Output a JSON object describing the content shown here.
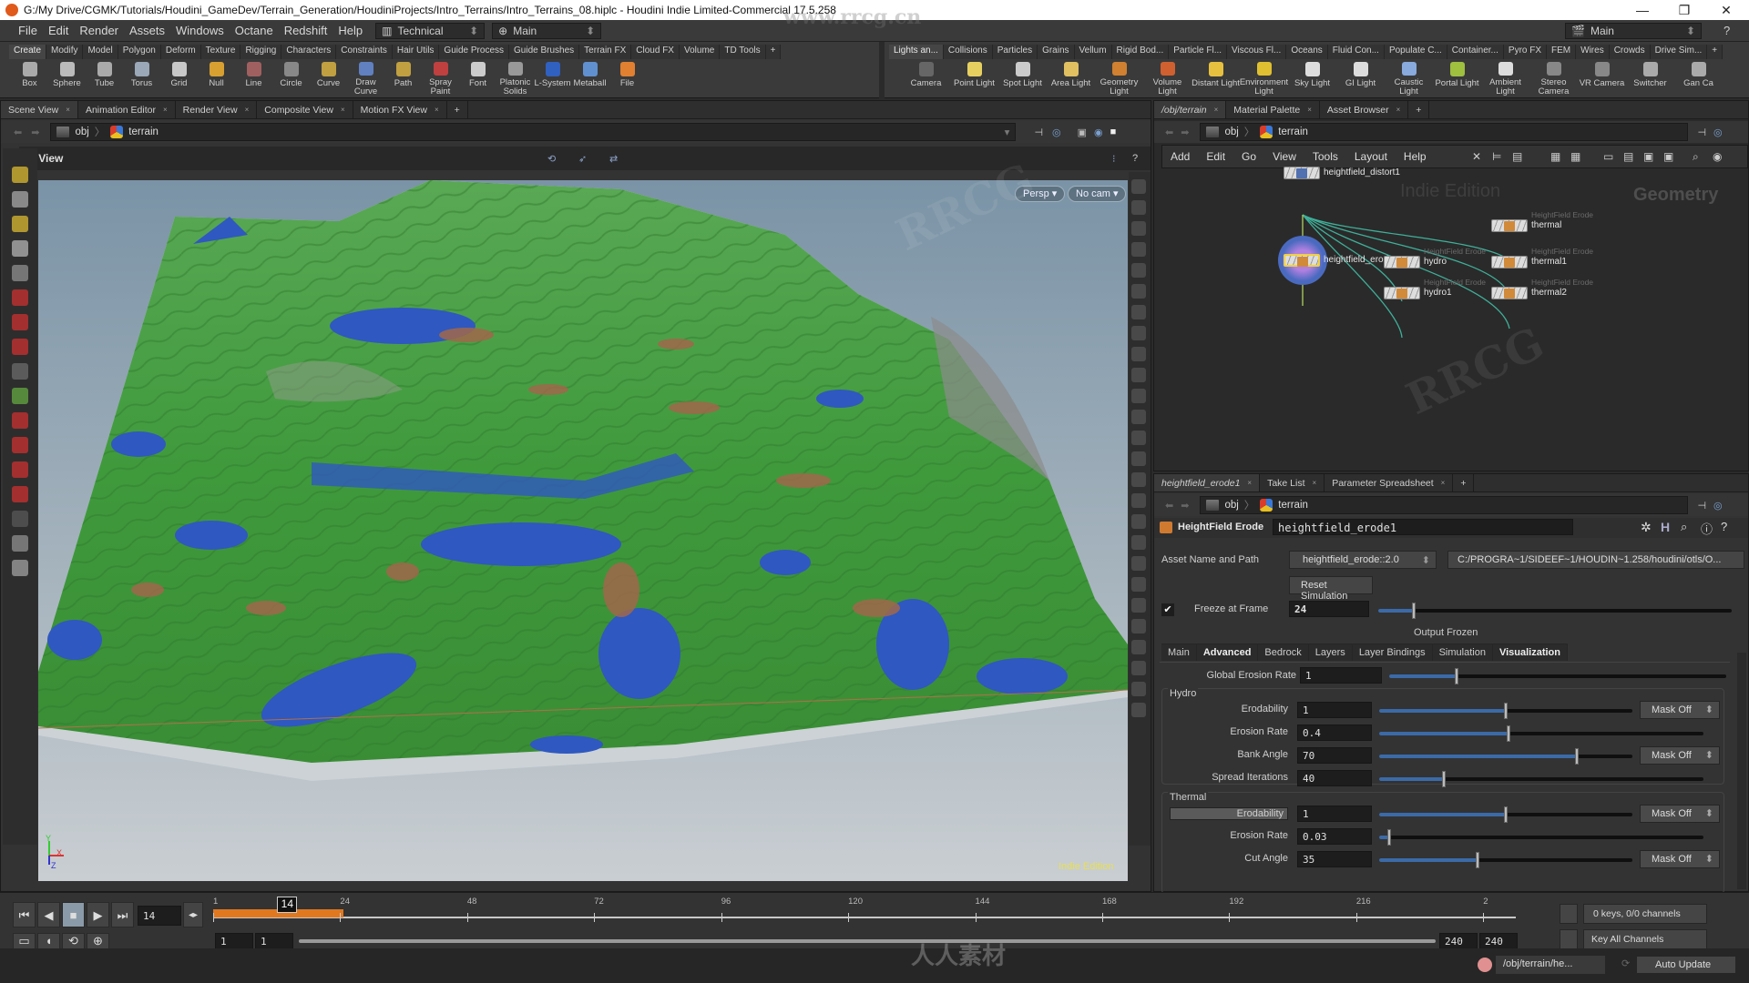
{
  "window": {
    "title": "G:/My Drive/CGMK/Tutorials/Houdini_GameDev/Terrain_Generation/HoudiniProjects/Intro_Terrains/Intro_Terrains_08.hiplc - Houdini Indie Limited-Commercial 17.5.258",
    "minimize": "—",
    "maximize": "❐",
    "close": "✕"
  },
  "menu": {
    "items": [
      "File",
      "Edit",
      "Render",
      "Assets",
      "Windows",
      "Octane",
      "Redshift",
      "Help"
    ],
    "desktop": "Technical",
    "context": "Main",
    "right_context": "Main"
  },
  "shelf_left": {
    "tabs": [
      "Create",
      "Modify",
      "Model",
      "Polygon",
      "Deform",
      "Texture",
      "Rigging",
      "Characters",
      "Constraints",
      "Hair Utils",
      "Guide Process",
      "Guide Brushes",
      "Terrain FX",
      "Cloud FX",
      "Volume",
      "TD Tools",
      "+"
    ],
    "tools": [
      {
        "label": "Box",
        "color": "#aaaaaa"
      },
      {
        "label": "Sphere",
        "color": "#bbbbbb"
      },
      {
        "label": "Tube",
        "color": "#aaaaaa"
      },
      {
        "label": "Torus",
        "color": "#9aa8b8"
      },
      {
        "label": "Grid",
        "color": "#c8c8c8"
      },
      {
        "label": "Null",
        "color": "#d8a030"
      },
      {
        "label": "Line",
        "color": "#a06060"
      },
      {
        "label": "Circle",
        "color": "#888888"
      },
      {
        "label": "Curve",
        "color": "#c0a040"
      },
      {
        "label": "Draw Curve",
        "color": "#6080c0"
      },
      {
        "label": "Path",
        "color": "#c0a040"
      },
      {
        "label": "Spray Paint",
        "color": "#c04040"
      },
      {
        "label": "Font",
        "color": "#cccccc"
      },
      {
        "label": "Platonic Solids",
        "color": "#999999"
      },
      {
        "label": "L-System",
        "color": "#3060c0"
      },
      {
        "label": "Metaball",
        "color": "#6090d0"
      },
      {
        "label": "File",
        "color": "#e08030"
      }
    ]
  },
  "shelf_right": {
    "tabs": [
      "Lights an...",
      "Collisions",
      "Particles",
      "Grains",
      "Vellum",
      "Rigid Bod...",
      "Particle Fl...",
      "Viscous Fl...",
      "Oceans",
      "Fluid Con...",
      "Populate C...",
      "Container...",
      "Pyro FX",
      "FEM",
      "Wires",
      "Crowds",
      "Drive Sim...",
      "+"
    ],
    "tools": [
      {
        "label": "Camera",
        "color": "#666666"
      },
      {
        "label": "Point Light",
        "color": "#e8d060"
      },
      {
        "label": "Spot Light",
        "color": "#cccccc"
      },
      {
        "label": "Area Light",
        "color": "#e0c060"
      },
      {
        "label": "Geometry Light",
        "color": "#d08030"
      },
      {
        "label": "Volume Light",
        "color": "#d06030"
      },
      {
        "label": "Distant Light",
        "color": "#e8c040"
      },
      {
        "label": "Environment Light",
        "color": "#e0c030"
      },
      {
        "label": "Sky Light",
        "color": "#dddddd"
      },
      {
        "label": "GI Light",
        "color": "#dddddd"
      },
      {
        "label": "Caustic Light",
        "color": "#88aadd"
      },
      {
        "label": "Portal Light",
        "color": "#a0c040"
      },
      {
        "label": "Ambient Light",
        "color": "#dddddd"
      },
      {
        "label": "Stereo Camera",
        "color": "#888888"
      },
      {
        "label": "VR Camera",
        "color": "#888888"
      },
      {
        "label": "Switcher",
        "color": "#aaaaaa"
      },
      {
        "label": "Gan Ca",
        "color": "#aaaaaa"
      }
    ]
  },
  "scene_panel": {
    "tabs": [
      "Scene View",
      "Animation Editor",
      "Render View",
      "Composite View",
      "Motion FX View",
      "+"
    ],
    "path": [
      "obj",
      "terrain"
    ],
    "view_label": "View",
    "persp_button": "Persp ▾",
    "cam_button": "No cam ▾",
    "indie_label": "Indie Edition",
    "axis": {
      "x": "X",
      "y": "Y",
      "z": "Z"
    }
  },
  "network_panel": {
    "tabs": [
      "/obj/terrain",
      "Material Palette",
      "Asset Browser",
      "+"
    ],
    "path": [
      "obj",
      "terrain"
    ],
    "menu": [
      "Add",
      "Edit",
      "Go",
      "View",
      "Tools",
      "Layout",
      "Help"
    ],
    "watermark_indie": "Indie Edition",
    "context_label": "Geometry",
    "nodes": [
      {
        "name": "heightfield_distort1",
        "type": ""
      },
      {
        "name": "heightfield_erode1",
        "type": "",
        "selected": true
      },
      {
        "name": "hydro",
        "type": "HeightField Erode"
      },
      {
        "name": "hydro1",
        "type": "HeightField Erode"
      },
      {
        "name": "thermal",
        "type": "HeightField Erode"
      },
      {
        "name": "thermal1",
        "type": "HeightField Erode"
      },
      {
        "name": "thermal2",
        "type": "HeightField Erode"
      }
    ]
  },
  "parm_panel": {
    "tabs": [
      "heightfield_erode1",
      "Take List",
      "Parameter Spreadsheet",
      "+"
    ],
    "path": [
      "obj",
      "terrain"
    ],
    "node_type": "HeightField Erode",
    "node_name": "heightfield_erode1",
    "asset_label": "Asset Name and Path",
    "asset_name": "heightfield_erode::2.0",
    "asset_path": "C:/PROGRA~1/SIDEEF~1/HOUDIN~1.258/houdini/otls/O...",
    "reset_button": "Reset Simulation",
    "freeze": {
      "checked": true,
      "label": "Freeze at Frame",
      "value": "24",
      "slider": 0.1
    },
    "status": "Output Frozen",
    "sub_tabs": [
      "Main",
      "Advanced",
      "Bedrock",
      "Layers",
      "Layer Bindings",
      "Simulation",
      "Visualization"
    ],
    "global_erosion": {
      "label": "Global Erosion Rate",
      "value": "1",
      "slider": 0.2
    },
    "hydro": {
      "title": "Hydro",
      "params": [
        {
          "label": "Erodability",
          "value": "1",
          "slider": 0.5,
          "mask": "Mask Off"
        },
        {
          "label": "Erosion Rate",
          "value": "0.4",
          "slider": 0.4,
          "mask": ""
        },
        {
          "label": "Bank Angle",
          "value": "70",
          "slider": 0.78,
          "mask": "Mask Off"
        },
        {
          "label": "Spread Iterations",
          "value": "40",
          "slider": 0.2,
          "mask": ""
        }
      ]
    },
    "thermal": {
      "title": "Thermal",
      "params": [
        {
          "label": "Erodability",
          "value": "1",
          "slider": 0.5,
          "mask": "Mask Off"
        },
        {
          "label": "Erosion Rate",
          "value": "0.03",
          "slider": 0.03,
          "mask": ""
        },
        {
          "label": "Cut Angle",
          "value": "35",
          "slider": 0.39,
          "mask": "Mask Off"
        }
      ]
    }
  },
  "timeline": {
    "current_frame": "14",
    "ticks": [
      "1",
      "24",
      "48",
      "72",
      "96",
      "120",
      "144",
      "168",
      "192",
      "216",
      "2"
    ],
    "cached_fraction": 0.1,
    "range_start": "1",
    "range_start2": "1",
    "range_end": "240",
    "range_end2": "240",
    "keys_status": "0 keys, 0/0 channels",
    "key_mode": "Key All Channels"
  },
  "status": {
    "path": "/obj/terrain/he...",
    "update_mode": "Auto Update"
  },
  "watermarks": [
    "www.rrcg.cn",
    "RRCG",
    "人人素材"
  ]
}
